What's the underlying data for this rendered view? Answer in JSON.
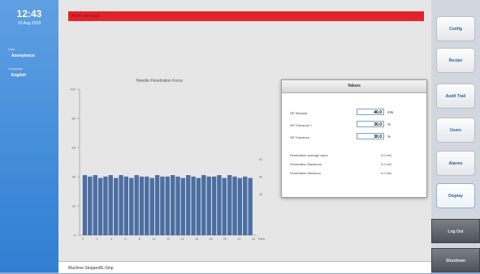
{
  "sidebar": {
    "time": "12:43",
    "date": "23 Aug 2019",
    "user_label": "User",
    "user_value": "Anonymous",
    "language_label": "Language",
    "language_value": "English"
  },
  "header": {
    "alarm_text": "Alarm message"
  },
  "values_panel": {
    "title": "Values",
    "inputs": [
      {
        "label": "NP Setpoint",
        "value": "40.0",
        "unit": "mN"
      },
      {
        "label": "NP Tolerance +",
        "value": "30.0",
        "unit": "%"
      },
      {
        "label": "NP Tolerance -",
        "value": "30.0",
        "unit": "%"
      }
    ],
    "readouts": [
      {
        "label": "Penetration average value",
        "value": "0.0 mN"
      },
      {
        "label": "Penetration Maximum",
        "value": "0.0 mN"
      },
      {
        "label": "Penetration Minimum",
        "value": "0.0 mN"
      }
    ]
  },
  "buttons": [
    {
      "label": "Config",
      "selected": false
    },
    {
      "label": "Recipe",
      "selected": false
    },
    {
      "label": "Audit Trail",
      "selected": false
    },
    {
      "label": "Users",
      "selected": false
    },
    {
      "label": "Alarms",
      "selected": false
    },
    {
      "label": "Display",
      "selected": true
    }
  ],
  "bottom_buttons": [
    {
      "label": "Log Out"
    },
    {
      "label": "Shutdown"
    }
  ],
  "status": {
    "text": "Machine Stopped/E-Stop"
  },
  "chart_data": {
    "type": "bar",
    "title": "Needle Penetration Force",
    "categories": [
      "1",
      "2",
      "3",
      "4",
      "5",
      "6",
      "7",
      "8",
      "9",
      "10",
      "11",
      "12",
      "13",
      "14",
      "15",
      "16",
      "17",
      "18",
      "19",
      "20",
      "21",
      "22",
      "23",
      "24",
      "25",
      "26",
      "27",
      "28",
      "29",
      "30",
      "31",
      "32",
      "33"
    ],
    "values": [
      41,
      40,
      41,
      39,
      40,
      41,
      39,
      41,
      40,
      39,
      41,
      40,
      40,
      39,
      41,
      40,
      40,
      41,
      40,
      39,
      41,
      40,
      39,
      41,
      40,
      40,
      41,
      39,
      41,
      40,
      39,
      40,
      39
    ],
    "ylim": [
      0,
      100
    ],
    "y_ticks": [
      0,
      20,
      40,
      60,
      80,
      100
    ],
    "x_ticks": [
      "0",
      "2",
      "4",
      "6",
      "8",
      "10",
      "12",
      "14",
      "16",
      "18",
      "20",
      "22",
      "24"
    ],
    "ref_lines": [
      {
        "value": 52,
        "label": "52"
      },
      {
        "value": 40,
        "label": "40"
      },
      {
        "value": 28,
        "label": "28"
      }
    ],
    "x_unit": "Parts",
    "bar_color": "#4a6fa5"
  }
}
